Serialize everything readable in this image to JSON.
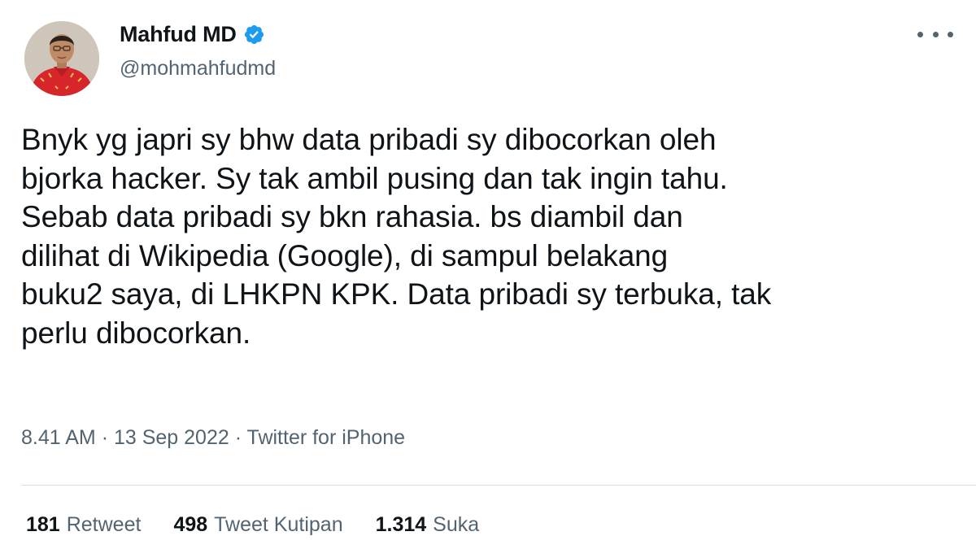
{
  "author": {
    "name": "Mahfud MD",
    "handle": "@mohmahfudmd",
    "verified": true,
    "verified_color": "#1d9bf0"
  },
  "tweet": {
    "text": "Bnyk yg japri sy bhw data pribadi sy dibocorkan oleh\nbjorka hacker. Sy tak ambil pusing dan tak ingin tahu.\nSebab data pribadi sy bkn rahasia. bs diambil dan\ndilihat di Wikipedia (Google), di sampul belakang\nbuku2 saya, di LHKPN KPK. Data pribadi sy terbuka, tak\nperlu dibocorkan.",
    "time": "8.41 AM",
    "separator": "·",
    "date": "13 Sep 2022",
    "source": "Twitter for iPhone"
  },
  "stats": {
    "retweets": {
      "count": "181",
      "label": "Retweet"
    },
    "quotes": {
      "count": "498",
      "label": "Tweet Kutipan"
    },
    "likes": {
      "count": "1.314",
      "label": "Suka"
    }
  },
  "icons": {
    "more": "more-options-icon",
    "verified": "verified-badge-icon",
    "avatar": "profile-avatar"
  },
  "colors": {
    "text": "#0f1419",
    "secondary": "#536471",
    "divider": "#d6dde2"
  }
}
